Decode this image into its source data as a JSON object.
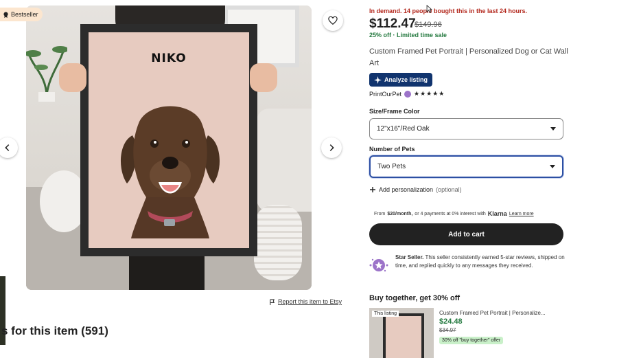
{
  "badge": {
    "label": "Bestseller"
  },
  "photo": {
    "pet_name": "NIKO"
  },
  "report_link": "Report this item to Etsy",
  "reviews_heading": "s for this item (591)",
  "listing": {
    "demand": "In demand. 14 people bought this in the last 24 hours.",
    "price": "$112.47",
    "original_price": "$149.96",
    "discount": "25% off · Limited time sale",
    "title": "Custom Framed Pet Portrait | Personalized Dog or Cat Wall Art",
    "analyze_label": "Analyze listing",
    "shop_name": "PrintOurPet",
    "rating_stars": "★★★★★"
  },
  "options": {
    "size_label": "Size/Frame Color",
    "size_value": "12\"x16\"/Red Oak",
    "pets_label": "Number of Pets",
    "pets_value": "Two Pets",
    "add_personalization": "Add personalization",
    "optional": "(optional)"
  },
  "klarna": {
    "prefix": "From",
    "amount": "$20/month,",
    "text": "or 4 payments at 0% interest with",
    "brand": "Klarna",
    "learn_more": "Learn more"
  },
  "cart": {
    "label": "Add to cart"
  },
  "star_seller": {
    "title": "Star Seller.",
    "text": "This seller consistently earned 5-star reviews, shipped on time, and replied quickly to any messages they received."
  },
  "buy_together": {
    "heading": "Buy together, get 30% off",
    "tag": "This listing",
    "item_title": "Custom Framed Pet Portrait | Personalize...",
    "price": "$24.48",
    "old_price": "$34.97",
    "offer": "30% off \"buy together\" offer"
  },
  "colors": {
    "demand_red": "#b3271c",
    "sale_green": "#24793f",
    "analyze_navy": "#11346e",
    "select_focus": "#2c4fa3",
    "cart_black": "#222222",
    "bestseller_bg": "#fce6cf"
  },
  "icons": [
    "bestseller-icon",
    "heart-icon",
    "chevron-left-icon",
    "chevron-right-icon",
    "flag-icon",
    "plus-icon",
    "star-seller-icon",
    "sparkle-icon"
  ]
}
